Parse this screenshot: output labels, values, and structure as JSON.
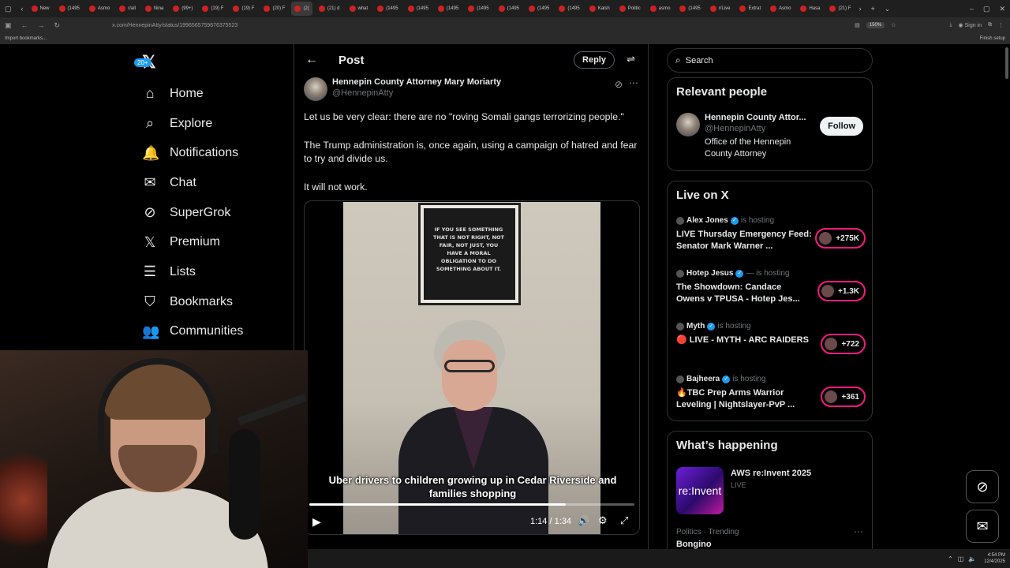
{
  "browser": {
    "tabs": [
      {
        "label": "New"
      },
      {
        "label": "(1495"
      },
      {
        "label": "Asmo"
      },
      {
        "label": "r/all"
      },
      {
        "label": "Nina"
      },
      {
        "label": "(99+)"
      },
      {
        "label": "(19) F"
      },
      {
        "label": "(19) F"
      },
      {
        "label": "(20) F"
      },
      {
        "label": "(2(",
        "active": true
      },
      {
        "label": "(21) d"
      },
      {
        "label": "what"
      },
      {
        "label": "(1495"
      },
      {
        "label": "(1495"
      },
      {
        "label": "(1495"
      },
      {
        "label": "(1495"
      },
      {
        "label": "(1495"
      },
      {
        "label": "(1495"
      },
      {
        "label": "(1495"
      },
      {
        "label": "Kalsh"
      },
      {
        "label": "Politic"
      },
      {
        "label": "asmo"
      },
      {
        "label": "(1495"
      },
      {
        "label": "r/Live"
      },
      {
        "label": "Extrat"
      },
      {
        "label": "Asmo"
      },
      {
        "label": "Hasa"
      },
      {
        "label": "(21) F"
      }
    ],
    "url": "x.com/HennepinAtty/status/1996565759676375523",
    "zoom": "150%",
    "bookmark": "Import bookmarks...",
    "finish_setup": "Finish setup",
    "signin": "Sign in"
  },
  "nav": {
    "items": [
      {
        "label": "Home",
        "icon": "home-icon",
        "glyph": "⌂"
      },
      {
        "label": "Explore",
        "icon": "search-icon",
        "glyph": "⌕"
      },
      {
        "label": "Notifications",
        "icon": "bell-icon",
        "glyph": "🔔",
        "badge": "20+"
      },
      {
        "label": "Chat",
        "icon": "mail-icon",
        "glyph": "✉"
      },
      {
        "label": "SuperGrok",
        "icon": "grok-icon",
        "glyph": "⊘"
      },
      {
        "label": "Premium",
        "icon": "x-icon",
        "glyph": "𝕏"
      },
      {
        "label": "Lists",
        "icon": "list-icon",
        "glyph": "☰"
      },
      {
        "label": "Bookmarks",
        "icon": "bookmark-icon",
        "glyph": "⛉"
      },
      {
        "label": "Communities",
        "icon": "people-icon",
        "glyph": "👥"
      }
    ]
  },
  "post": {
    "header_title": "Post",
    "reply_label": "Reply",
    "author_name": "Hennepin County Attorney Mary Moriarty",
    "author_handle": "@HennepinAtty",
    "paragraphs": [
      "Let us be very clear: there are no \"roving Somali gangs terrorizing people.\"",
      "The Trump administration is, once again, using a campaign of hatred and fear to try and divide us.",
      "It will not work."
    ],
    "video": {
      "poster_text": "IF YOU SEE SOMETHING THAT IS NOT RIGHT, NOT FAIR, NOT JUST, YOU HAVE A MORAL OBLIGATION TO DO SOMETHING ABOUT IT.",
      "caption": "Uber drivers to children growing up in Cedar Riverside and families shopping",
      "timecode": "1:14 / 1:34",
      "progress": 0.79
    }
  },
  "sidebar": {
    "search_placeholder": "Search",
    "relevant": {
      "title": "Relevant people",
      "name": "Hennepin County Attor...",
      "handle": "@HennepinAtty",
      "bio": "Office of the Hennepin County Attorney",
      "follow_label": "Follow"
    },
    "live": {
      "title": "Live on X",
      "items": [
        {
          "host": "Alex Jones",
          "hosting": "is hosting",
          "title": "LIVE Thursday Emergency Feed: Senator Mark Warner ...",
          "count": "+275K"
        },
        {
          "host": "Hotep Jesus",
          "hosting": "— is hosting",
          "title": "The Showdown: Candace Owens v TPUSA - Hotep Jes...",
          "count": "+1.3K"
        },
        {
          "host": "Myth",
          "hosting": "is hosting",
          "title": "🔴 LIVE - MYTH - ARC RAIDERS",
          "count": "+722"
        },
        {
          "host": "Bajheera",
          "hosting": "is hosting",
          "title": "🔥TBC Prep Arms Warrior Leveling | Nightslayer-PvP ...",
          "count": "+361"
        }
      ]
    },
    "happening": {
      "title": "What’s happening",
      "thumb_text": "re:Invent",
      "event_title": "AWS re:Invent 2025",
      "event_status": "LIVE",
      "trend_meta": "Politics · Trending",
      "trend_name": "Bongino"
    }
  },
  "taskbar": {
    "time": "4:54 PM",
    "date": "12/4/2025"
  },
  "colors": {
    "accent": "#1d9bf0",
    "live_ring": "#f91880",
    "border": "#2f3336",
    "muted": "#71767b"
  }
}
